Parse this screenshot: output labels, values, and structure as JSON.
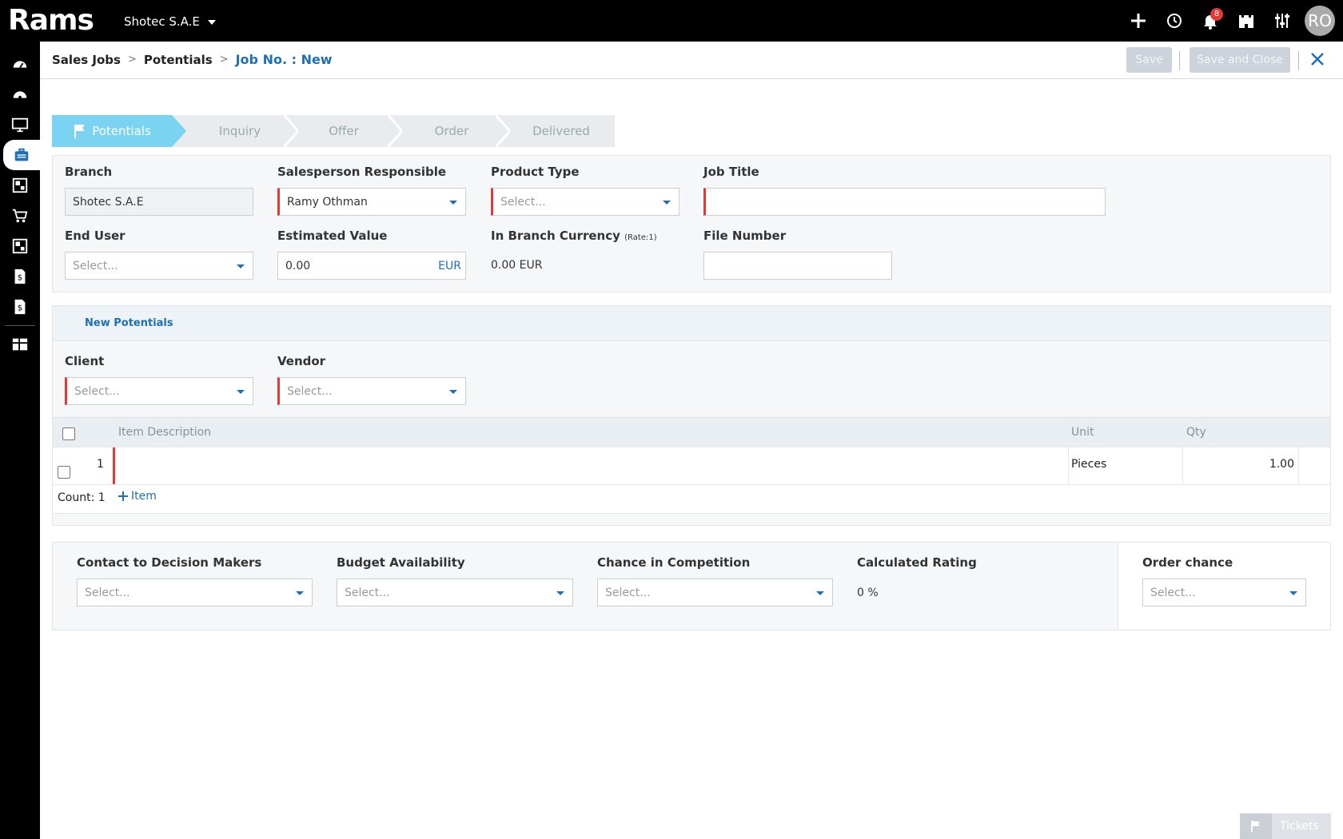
{
  "app": {
    "logo": "Rams",
    "company": "Shotec S.A.E",
    "notification_count": "8",
    "user_initials": "RO"
  },
  "sidebar": {
    "items": [
      "dashboard-icon",
      "speedometer-icon",
      "monitor-icon",
      "briefcase-icon",
      "modules-icon",
      "cart-icon",
      "modules-icon",
      "dollar-doc-icon",
      "dollar-doc-icon",
      "table-icon"
    ]
  },
  "header": {
    "breadcrumb": [
      "Sales Jobs",
      "Potentials"
    ],
    "current": "Job No. : New",
    "save_label": "Save",
    "save_close_label": "Save and Close"
  },
  "steps": [
    "Potentials",
    "Inquiry",
    "Offer",
    "Order",
    "Delivered"
  ],
  "form": {
    "branch_label": "Branch",
    "branch_value": "Shotec S.A.E",
    "salesperson_label": "Salesperson Responsible",
    "salesperson_value": "Ramy  Othman",
    "product_type_label": "Product Type",
    "product_type_placeholder": "Select...",
    "job_title_label": "Job Title",
    "job_title_value": "",
    "end_user_label": "End User",
    "end_user_placeholder": "Select...",
    "estimated_value_label": "Estimated Value",
    "estimated_value": "0.00",
    "currency": "EUR",
    "branch_currency_label": "In Branch Currency",
    "branch_currency_rate": "(Rate:1)",
    "branch_currency_value": "0.00  EUR",
    "file_number_label": "File Number",
    "file_number_value": ""
  },
  "potentials": {
    "section_title": "New Potentials",
    "client_label": "Client",
    "client_placeholder": "Select...",
    "vendor_label": "Vendor",
    "vendor_placeholder": "Select...",
    "columns": [
      "Item Description",
      "Unit",
      "Qty"
    ],
    "rows": [
      {
        "num": "1",
        "description": "",
        "unit": "Pieces",
        "qty": "1.00"
      }
    ],
    "count_label": "Count: 1",
    "add_item_label": "Item"
  },
  "rating": {
    "contact_label": "Contact to Decision Makers",
    "contact_placeholder": "Select...",
    "budget_label": "Budget Availability",
    "budget_placeholder": "Select...",
    "chance_label": "Chance in Competition",
    "chance_placeholder": "Select...",
    "calculated_label": "Calculated Rating",
    "calculated_value": "0 %",
    "order_chance_label": "Order chance",
    "order_chance_placeholder": "Select..."
  },
  "footer": {
    "tickets_label": "Tickets"
  },
  "colors": {
    "accent": "#1e6fb4",
    "step_active": "#7ad3f0",
    "required": "#e53935"
  }
}
